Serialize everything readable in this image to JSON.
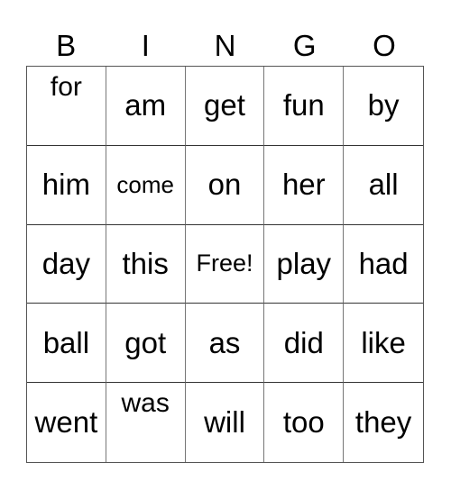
{
  "header": [
    "B",
    "I",
    "N",
    "G",
    "O"
  ],
  "cells": [
    "for",
    "am",
    "get",
    "fun",
    "by",
    "him",
    "come",
    "on",
    "her",
    "all",
    "day",
    "this",
    "Free!",
    "play",
    "had",
    "ball",
    "got",
    "as",
    "did",
    "like",
    "went",
    "was",
    "will",
    "too",
    "they"
  ]
}
